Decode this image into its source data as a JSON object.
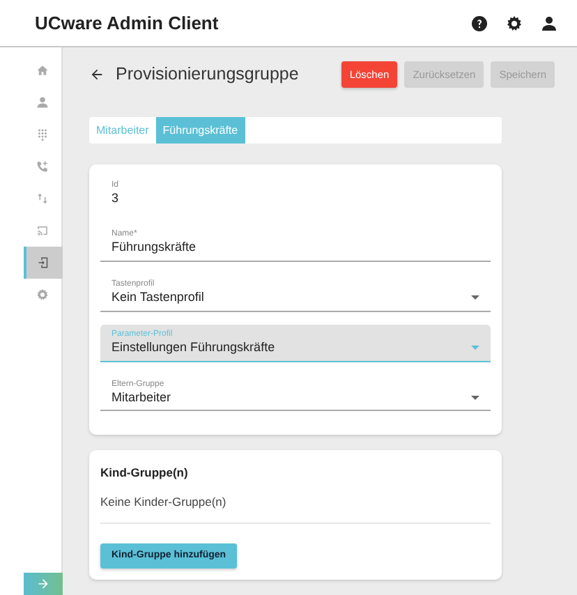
{
  "app_title": "UCware Admin Client",
  "sidebar": {
    "items": [
      {
        "selected": false
      },
      {
        "selected": false
      },
      {
        "selected": false
      },
      {
        "selected": false
      },
      {
        "selected": false
      },
      {
        "selected": false
      },
      {
        "selected": true
      },
      {
        "selected": false
      }
    ]
  },
  "page_title": "Provisionierungsgruppe",
  "actions": [
    {
      "label": "Löschen",
      "kind": "danger",
      "disabled": false
    },
    {
      "label": "Zurücksetzen",
      "kind": "plain",
      "disabled": true
    },
    {
      "label": "Speichern",
      "kind": "plain",
      "disabled": true
    }
  ],
  "tabs": [
    {
      "label": "Mitarbeiter",
      "selected": false
    },
    {
      "label": "Führungskräfte",
      "selected": true
    }
  ],
  "fields": [
    {
      "label": "Id",
      "value": "3",
      "kind": "readonly",
      "focused": false
    },
    {
      "label": "Name*",
      "value": "Führungskräfte",
      "kind": "input",
      "focused": false
    },
    {
      "label": "Tastenprofil",
      "value": "Kein Tastenprofil",
      "kind": "select",
      "focused": false
    },
    {
      "label": "Parameter-Profil",
      "value": "Einstellungen Führungskräfte",
      "kind": "select",
      "focused": true
    },
    {
      "label": "Eltern-Gruppe",
      "value": "Mitarbeiter",
      "kind": "select",
      "focused": false
    }
  ],
  "children_card": {
    "title": "Kind-Gruppe(n)",
    "empty_text": "Keine Kinder-Gruppe(n)",
    "button": "Kind-Gruppe hinzufügen"
  }
}
